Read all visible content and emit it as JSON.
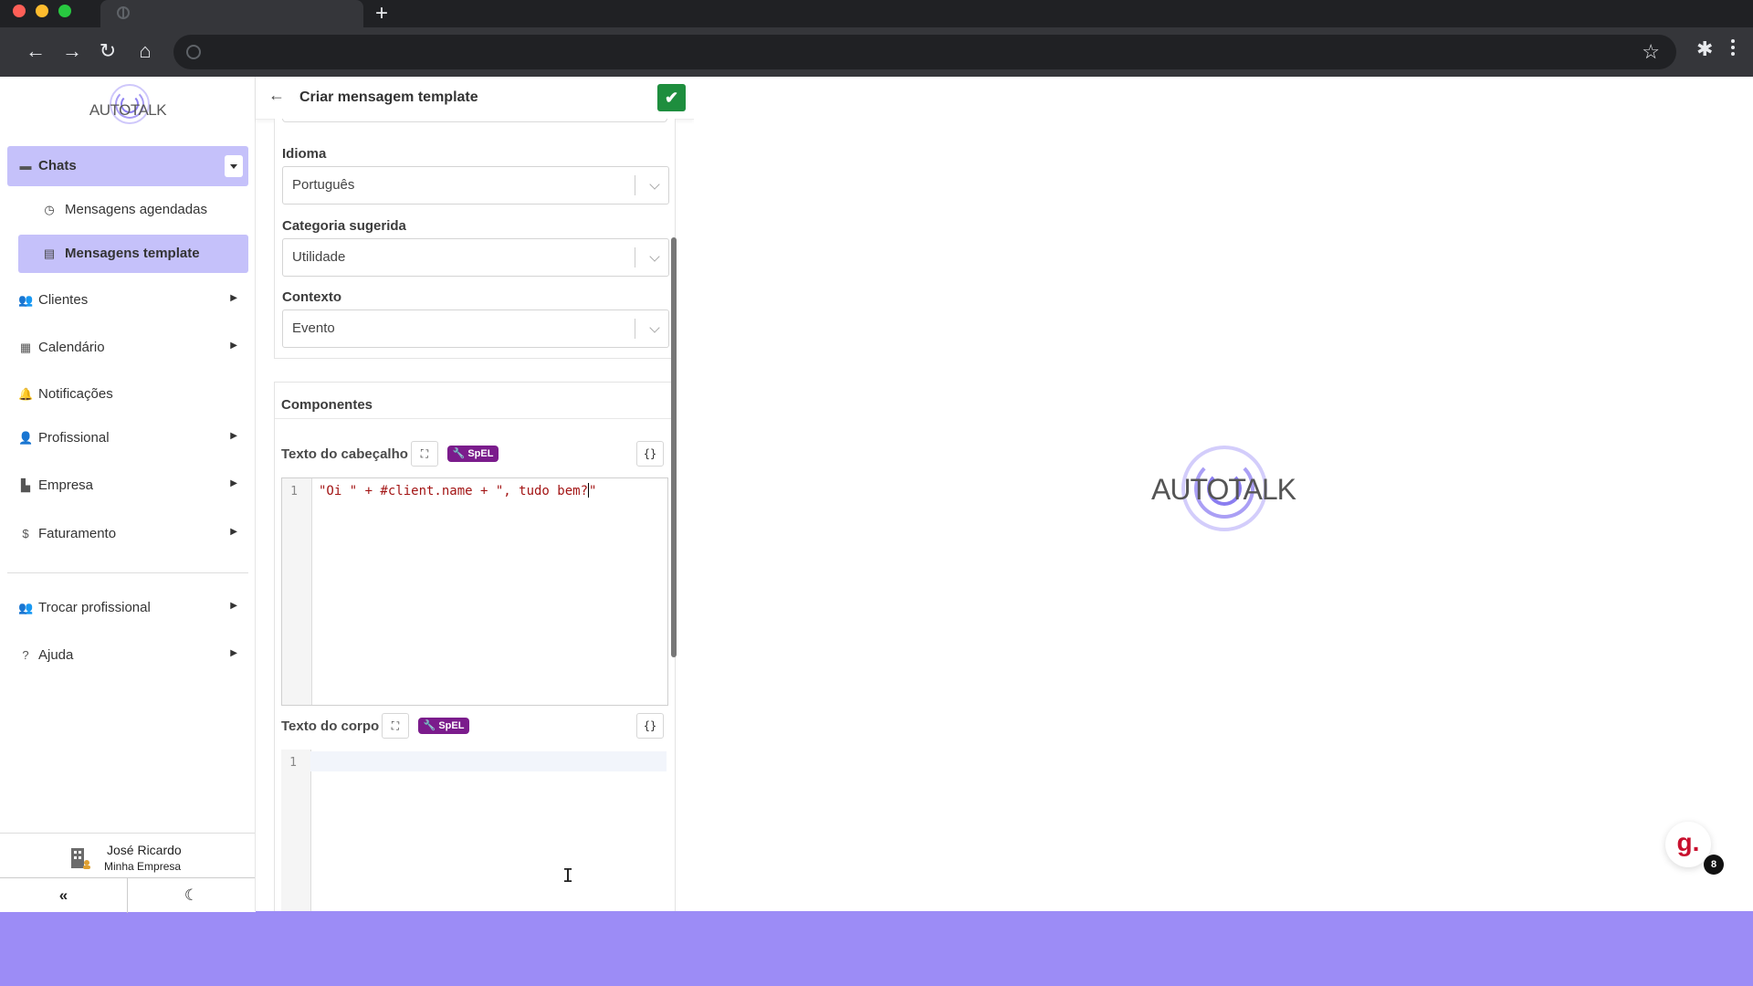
{
  "browser": {
    "new_tab": "+",
    "nav": {
      "back": "←",
      "forward": "→",
      "reload": "↻",
      "home": "⌂"
    },
    "star": "☆",
    "extensions": "✱"
  },
  "sidebar": {
    "logo_text": "AUTOTALK",
    "items": [
      {
        "label": "Chats",
        "icon": "chat-icon",
        "glyph": "▬"
      },
      {
        "label": "Mensagens agendadas",
        "icon": "clock-icon",
        "glyph": "◷"
      },
      {
        "label": "Mensagens template",
        "icon": "list-icon",
        "glyph": "▤"
      },
      {
        "label": "Clientes",
        "icon": "users-icon",
        "glyph": "👥"
      },
      {
        "label": "Calendário",
        "icon": "calendar-icon",
        "glyph": "▦"
      },
      {
        "label": "Notificações",
        "icon": "bell-icon",
        "glyph": "🔔"
      },
      {
        "label": "Profissional",
        "icon": "user-gear-icon",
        "glyph": "👤"
      },
      {
        "label": "Empresa",
        "icon": "building-icon",
        "glyph": "▙"
      },
      {
        "label": "Faturamento",
        "icon": "dollar-icon",
        "glyph": "$"
      },
      {
        "label": "Trocar profissional",
        "icon": "swap-users-icon",
        "glyph": "👥"
      },
      {
        "label": "Ajuda",
        "icon": "help-icon",
        "glyph": "?"
      }
    ],
    "caret": "▶",
    "user": {
      "name": "José Ricardo",
      "company": "Minha Empresa"
    },
    "collapse_label": "«",
    "theme_label": "☾"
  },
  "panel": {
    "back": "←",
    "title": "Criar mensagem template",
    "save": "✔",
    "fields": {
      "idioma": {
        "label": "Idioma",
        "value": "Português"
      },
      "categoria": {
        "label": "Categoria sugerida",
        "value": "Utilidade"
      },
      "contexto": {
        "label": "Contexto",
        "value": "Evento"
      }
    },
    "components_title": "Componentes",
    "header_editor": {
      "label": "Texto do cabeçalho",
      "spel": "🔧 SpEL",
      "expand": "⛶",
      "braces": "{}",
      "line_no": "1",
      "code": "\"Oi \" + #client.name + \", tudo bem?"
    },
    "body_editor": {
      "label": "Texto do corpo",
      "spel": "🔧 SpEL",
      "expand": "⛶",
      "braces": "{}",
      "line_no": "1"
    }
  },
  "splash": {
    "logo_text": "AUTOTALK"
  },
  "widget": {
    "letter": "g.",
    "badge": "8"
  }
}
